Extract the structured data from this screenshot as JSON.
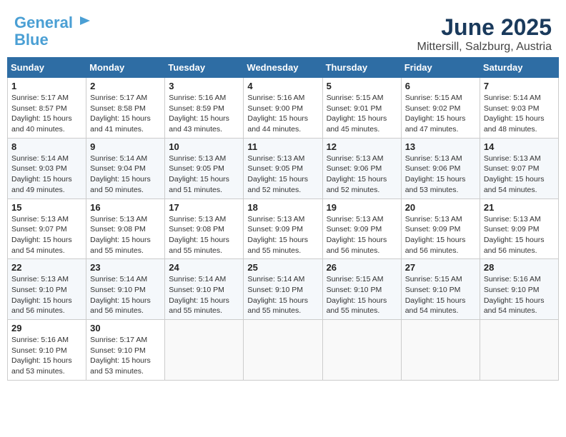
{
  "logo": {
    "line1": "General",
    "line2": "Blue"
  },
  "title": "June 2025",
  "location": "Mittersill, Salzburg, Austria",
  "days_of_week": [
    "Sunday",
    "Monday",
    "Tuesday",
    "Wednesday",
    "Thursday",
    "Friday",
    "Saturday"
  ],
  "weeks": [
    [
      {
        "day": "1",
        "info": "Sunrise: 5:17 AM\nSunset: 8:57 PM\nDaylight: 15 hours\nand 40 minutes."
      },
      {
        "day": "2",
        "info": "Sunrise: 5:17 AM\nSunset: 8:58 PM\nDaylight: 15 hours\nand 41 minutes."
      },
      {
        "day": "3",
        "info": "Sunrise: 5:16 AM\nSunset: 8:59 PM\nDaylight: 15 hours\nand 43 minutes."
      },
      {
        "day": "4",
        "info": "Sunrise: 5:16 AM\nSunset: 9:00 PM\nDaylight: 15 hours\nand 44 minutes."
      },
      {
        "day": "5",
        "info": "Sunrise: 5:15 AM\nSunset: 9:01 PM\nDaylight: 15 hours\nand 45 minutes."
      },
      {
        "day": "6",
        "info": "Sunrise: 5:15 AM\nSunset: 9:02 PM\nDaylight: 15 hours\nand 47 minutes."
      },
      {
        "day": "7",
        "info": "Sunrise: 5:14 AM\nSunset: 9:03 PM\nDaylight: 15 hours\nand 48 minutes."
      }
    ],
    [
      {
        "day": "8",
        "info": "Sunrise: 5:14 AM\nSunset: 9:03 PM\nDaylight: 15 hours\nand 49 minutes."
      },
      {
        "day": "9",
        "info": "Sunrise: 5:14 AM\nSunset: 9:04 PM\nDaylight: 15 hours\nand 50 minutes."
      },
      {
        "day": "10",
        "info": "Sunrise: 5:13 AM\nSunset: 9:05 PM\nDaylight: 15 hours\nand 51 minutes."
      },
      {
        "day": "11",
        "info": "Sunrise: 5:13 AM\nSunset: 9:05 PM\nDaylight: 15 hours\nand 52 minutes."
      },
      {
        "day": "12",
        "info": "Sunrise: 5:13 AM\nSunset: 9:06 PM\nDaylight: 15 hours\nand 52 minutes."
      },
      {
        "day": "13",
        "info": "Sunrise: 5:13 AM\nSunset: 9:06 PM\nDaylight: 15 hours\nand 53 minutes."
      },
      {
        "day": "14",
        "info": "Sunrise: 5:13 AM\nSunset: 9:07 PM\nDaylight: 15 hours\nand 54 minutes."
      }
    ],
    [
      {
        "day": "15",
        "info": "Sunrise: 5:13 AM\nSunset: 9:07 PM\nDaylight: 15 hours\nand 54 minutes."
      },
      {
        "day": "16",
        "info": "Sunrise: 5:13 AM\nSunset: 9:08 PM\nDaylight: 15 hours\nand 55 minutes."
      },
      {
        "day": "17",
        "info": "Sunrise: 5:13 AM\nSunset: 9:08 PM\nDaylight: 15 hours\nand 55 minutes."
      },
      {
        "day": "18",
        "info": "Sunrise: 5:13 AM\nSunset: 9:09 PM\nDaylight: 15 hours\nand 55 minutes."
      },
      {
        "day": "19",
        "info": "Sunrise: 5:13 AM\nSunset: 9:09 PM\nDaylight: 15 hours\nand 56 minutes."
      },
      {
        "day": "20",
        "info": "Sunrise: 5:13 AM\nSunset: 9:09 PM\nDaylight: 15 hours\nand 56 minutes."
      },
      {
        "day": "21",
        "info": "Sunrise: 5:13 AM\nSunset: 9:09 PM\nDaylight: 15 hours\nand 56 minutes."
      }
    ],
    [
      {
        "day": "22",
        "info": "Sunrise: 5:13 AM\nSunset: 9:10 PM\nDaylight: 15 hours\nand 56 minutes."
      },
      {
        "day": "23",
        "info": "Sunrise: 5:14 AM\nSunset: 9:10 PM\nDaylight: 15 hours\nand 56 minutes."
      },
      {
        "day": "24",
        "info": "Sunrise: 5:14 AM\nSunset: 9:10 PM\nDaylight: 15 hours\nand 55 minutes."
      },
      {
        "day": "25",
        "info": "Sunrise: 5:14 AM\nSunset: 9:10 PM\nDaylight: 15 hours\nand 55 minutes."
      },
      {
        "day": "26",
        "info": "Sunrise: 5:15 AM\nSunset: 9:10 PM\nDaylight: 15 hours\nand 55 minutes."
      },
      {
        "day": "27",
        "info": "Sunrise: 5:15 AM\nSunset: 9:10 PM\nDaylight: 15 hours\nand 54 minutes."
      },
      {
        "day": "28",
        "info": "Sunrise: 5:16 AM\nSunset: 9:10 PM\nDaylight: 15 hours\nand 54 minutes."
      }
    ],
    [
      {
        "day": "29",
        "info": "Sunrise: 5:16 AM\nSunset: 9:10 PM\nDaylight: 15 hours\nand 53 minutes."
      },
      {
        "day": "30",
        "info": "Sunrise: 5:17 AM\nSunset: 9:10 PM\nDaylight: 15 hours\nand 53 minutes."
      },
      {
        "day": "",
        "info": ""
      },
      {
        "day": "",
        "info": ""
      },
      {
        "day": "",
        "info": ""
      },
      {
        "day": "",
        "info": ""
      },
      {
        "day": "",
        "info": ""
      }
    ]
  ]
}
